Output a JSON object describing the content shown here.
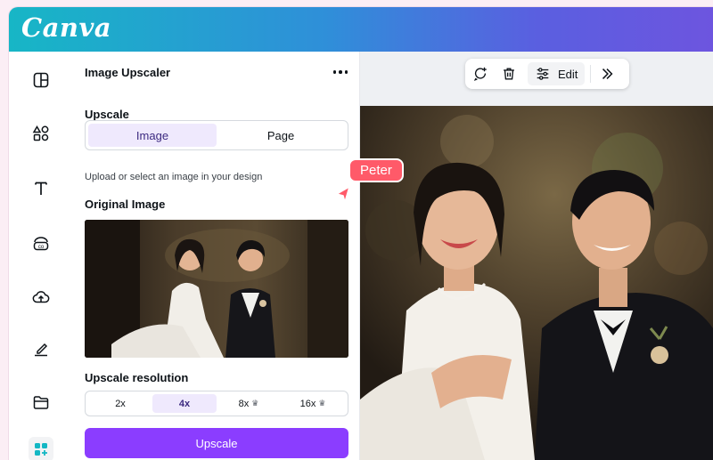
{
  "app": {
    "logo_text": "Canva"
  },
  "rail": {
    "items": [
      {
        "icon": "design-icon"
      },
      {
        "icon": "elements-icon"
      },
      {
        "icon": "text-icon"
      },
      {
        "icon": "brand-icon"
      },
      {
        "icon": "uploads-icon"
      },
      {
        "icon": "draw-icon"
      },
      {
        "icon": "projects-icon"
      },
      {
        "icon": "apps-icon"
      }
    ]
  },
  "panel": {
    "title": "Image Upscaler",
    "upscale_label": "Upscale",
    "target_options": [
      "Image",
      "Page"
    ],
    "target_selected": "Image",
    "hint": "Upload or select an image in your design",
    "original_label": "Original Image",
    "resolution_label": "Upscale resolution",
    "resolution_options": [
      {
        "label": "2x",
        "premium": false
      },
      {
        "label": "4x",
        "premium": false
      },
      {
        "label": "8x",
        "premium": true
      },
      {
        "label": "16x",
        "premium": true
      }
    ],
    "resolution_selected": "4x",
    "button_label": "Upscale"
  },
  "toolbar": {
    "edit_label": "Edit"
  },
  "collaborator": {
    "name": "Peter",
    "color": "#ff5a69"
  },
  "colors": {
    "accent": "#8b3dff",
    "selected_bg": "#efe9fd"
  }
}
